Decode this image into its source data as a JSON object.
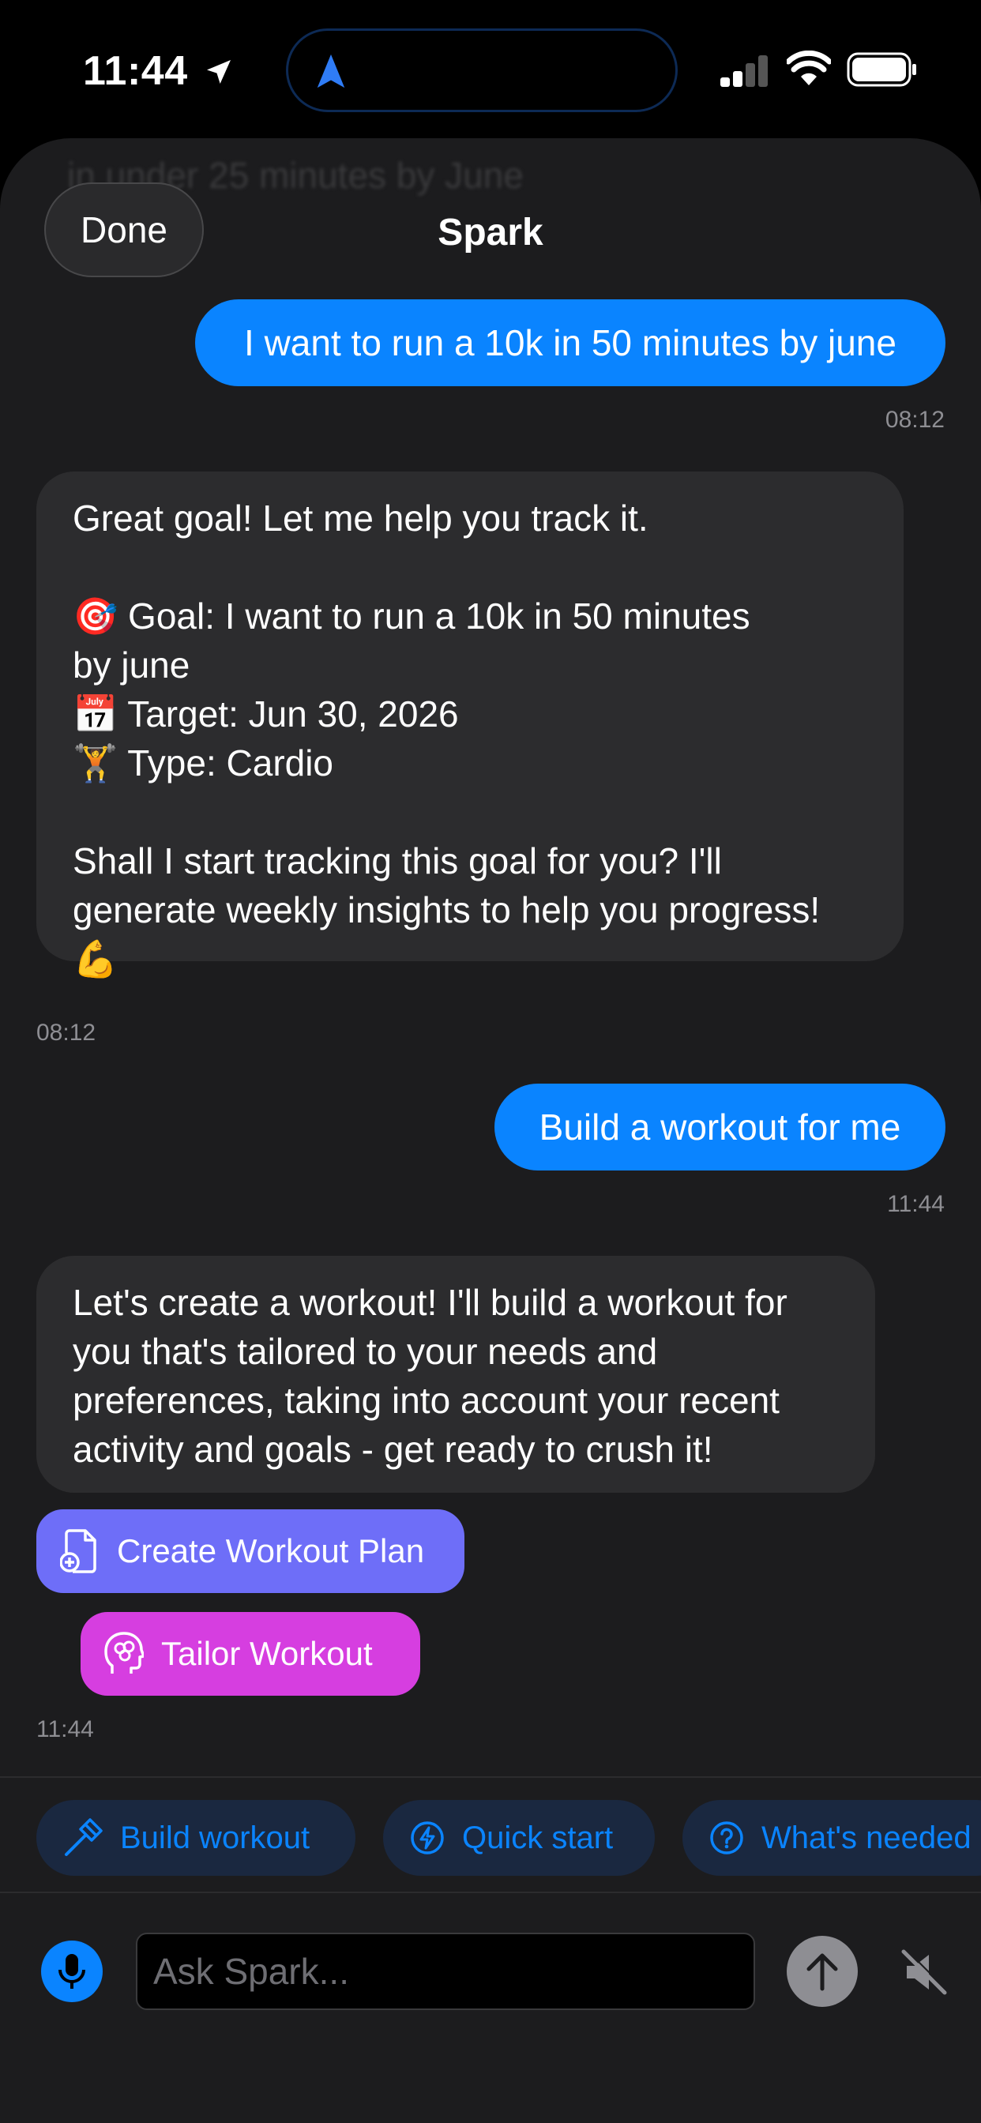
{
  "status_bar": {
    "time": "11:44"
  },
  "header": {
    "done_label": "Done",
    "title": "Spark",
    "ghost_text": "in under 25 minutes by June"
  },
  "messages": [
    {
      "role": "user",
      "text": "I want to run a 10k in 50 minutes by june",
      "time": "08:12"
    },
    {
      "role": "assistant",
      "text": "Great goal! Let me help you track it.\n\n🎯 Goal: I want to run a 10k in 50 minutes\nby june\n📅 Target: Jun 30, 2026\n🏋️ Type: Cardio\n\nShall I start tracking this goal for you? I'll\ngenerate weekly insights to help you progress!\n💪",
      "time": "08:12"
    },
    {
      "role": "user",
      "text": "Build a workout for me",
      "time": "11:44"
    },
    {
      "role": "assistant",
      "text": "Let's create a workout! I'll build a workout for\nyou that's tailored to your needs and\npreferences, taking into account your recent\nactivity and goals - get ready to crush it!",
      "actions": [
        "Create Workout Plan",
        "Tailor Workout"
      ],
      "time": "11:44"
    }
  ],
  "suggestions": [
    "Build workout",
    "Quick start",
    "What's needed"
  ],
  "input": {
    "placeholder": "Ask Spark..."
  },
  "colors": {
    "accent": "#0a84ff",
    "create_plan": "#6e6ef8",
    "tailor": "#d63ee0",
    "background": "#1c1c1e"
  }
}
